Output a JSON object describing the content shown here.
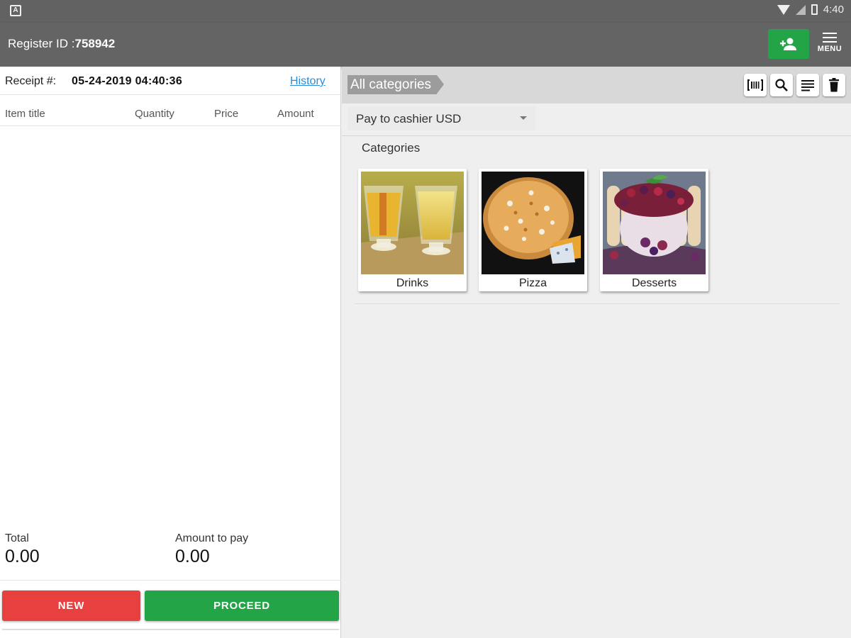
{
  "statusbar": {
    "time": "4:40",
    "app_icon_letter": "A"
  },
  "appbar": {
    "register_label": "Register ID :",
    "register_id": "758942",
    "menu_label": "MENU"
  },
  "receipt": {
    "label": "Receipt #:",
    "value": "05-24-2019 04:40:36",
    "history_link": "History"
  },
  "columns": [
    "Item title",
    "Quantity",
    "Price",
    "Amount"
  ],
  "totals": {
    "total_label": "Total",
    "total_value": "0.00",
    "pay_label": "Amount to pay",
    "pay_value": "0.00"
  },
  "buttons": {
    "new_label": "NEW",
    "proceed_label": "PROCEED"
  },
  "breadcrumb": "All categories",
  "toolbar_icons": [
    "barcode-icon",
    "search-icon",
    "list-icon",
    "trash-icon"
  ],
  "payment_method": "Pay to cashier USD",
  "categories_title": "Categories",
  "categories": [
    {
      "label": "Drinks",
      "image": "drinks-photo"
    },
    {
      "label": "Pizza",
      "image": "pizza-photo"
    },
    {
      "label": "Desserts",
      "image": "desserts-photo"
    }
  ],
  "colors": {
    "appbar": "#646464",
    "green": "#22a447",
    "red": "#e8403f",
    "link": "#2a8ed6"
  }
}
